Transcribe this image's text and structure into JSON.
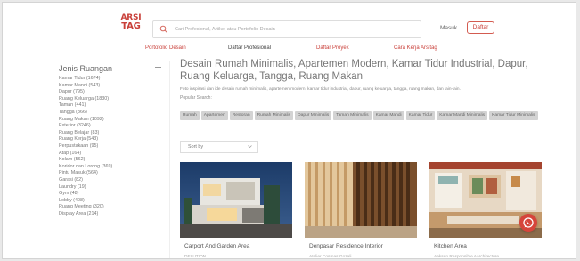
{
  "header": {
    "logo_line1": "ARSI",
    "logo_line2": "TAG",
    "search_placeholder": "Cari Profesional, Artikel atau Portofolio Desain",
    "masuk_label": "Masuk",
    "daftar_label": "Daftar"
  },
  "nav": {
    "items": [
      "Portofolio Desain",
      "Daftar Profesional",
      "Daftar Proyek",
      "Cara Kerja Arsitag"
    ]
  },
  "sidebar": {
    "title": "Jenis Ruangan",
    "items": [
      "Kamar Tidur (1674)",
      "Kamar Mandi (543)",
      "Dapur (795)",
      "Ruang Keluarga (1830)",
      "Taman (441)",
      "Tangga (366)",
      "Ruang Makan (1092)",
      "Exterior (3246)",
      "Ruang Belajar (83)",
      "Ruang Kerja (543)",
      "Perpustakaan (95)",
      "Atap (164)",
      "Kolam (562)",
      "Koridor dan Lorong (369)",
      "Pintu Masuk (564)",
      "Garasi (82)",
      "Laundry (19)",
      "Gym (48)",
      "Lobby (408)",
      "Ruang Meeting (320)",
      "Display Area (214)"
    ]
  },
  "main": {
    "title": "Desain Rumah Minimalis, Apartemen Modern, Kamar Tidur Industrial, Dapur, Ruang Keluarga, Tangga, Ruang Makan",
    "description": "Foto inspirasi dan ide desain rumah minimalis, apartemen modern, kamar tidur industrial, dapur, ruang keluarga, tangga, ruang makan, dan lain-lain.",
    "popular_label": "Popular Search:",
    "tags": [
      "Rumah",
      "Apartemen",
      "Restoran",
      "Rumah Minimalis",
      "Dapur Minimalis",
      "Taman Minimalis",
      "Kamar Mandi",
      "Kamar Tidur",
      "Kamar Mandi Minimalis",
      "Kamar Tidur Minimalis"
    ],
    "sort_label": "Sort by"
  },
  "cards": [
    {
      "title": "Carport And Garden Area",
      "subtitle": "DELUTION"
    },
    {
      "title": "Denpasar Residence Interior",
      "subtitle": "Atelier Cosmas Gozali"
    },
    {
      "title": "Kitchen Area",
      "subtitle": "Aaksen Responsible Aarchitecture"
    }
  ],
  "icons": {
    "search": "search-icon",
    "chevron": "chevron-down-icon",
    "collapse": "minus-icon",
    "chat": "whatsapp-icon"
  },
  "colors": {
    "brand": "#c9403a",
    "tag_bg": "#d3d3d3",
    "chat_button": "#d6453b"
  }
}
